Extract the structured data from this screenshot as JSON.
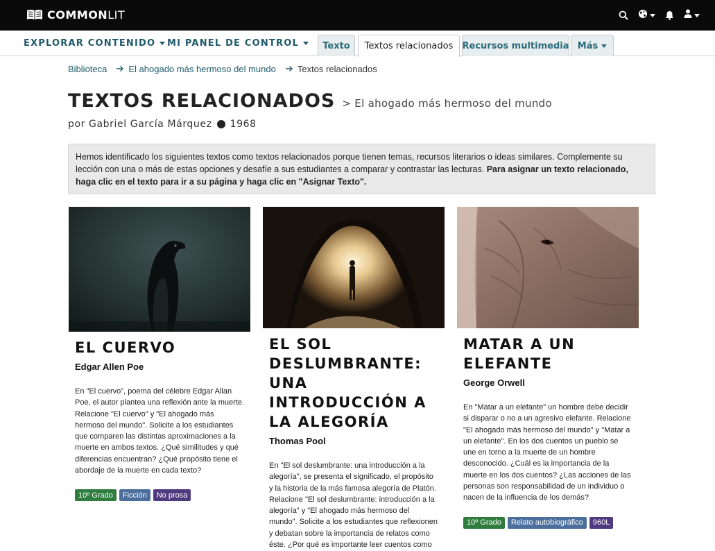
{
  "header": {
    "logo_bold": "COMMON",
    "logo_light": "LIT",
    "icons": [
      "search-icon",
      "globe-icon",
      "bell-icon",
      "user-icon"
    ]
  },
  "subnav": {
    "explore_label": "EXPLORAR CONTENIDO",
    "dashboard_label": "MI PANEL DE CONTROL",
    "tabs": [
      {
        "label": "Texto",
        "active": false
      },
      {
        "label": "Textos relacionados",
        "active": true
      },
      {
        "label": "Recursos multimedia",
        "active": false
      },
      {
        "label": "Más",
        "active": false
      }
    ]
  },
  "breadcrumb": {
    "items": [
      "Biblioteca",
      "El ahogado más hermoso del mundo"
    ],
    "current": "Textos relacionados"
  },
  "page": {
    "title": "TEXTOS RELACIONADOS",
    "subtitle": "> El ahogado más hermoso del mundo",
    "byline_author": "por Gabriel García Márquez",
    "byline_year": "1968"
  },
  "info": {
    "text": "Hemos identificado los siguientes textos como textos relacionados porque tienen temas, recursos literarios o ideas similares. Complemente su lección con una o más de estas opciones y desafíe a sus estudiantes a comparar y contrastar las lecturas.",
    "bold": "Para asignar un texto relacionado, haga clic en el texto para ir a su página y haga clic en \"Asignar Texto\"."
  },
  "cards": [
    {
      "title": "EL CUERVO",
      "author": "Edgar Allen Poe",
      "image": "raven-photo",
      "description": "En \"El cuervo\", poema del célebre Edgar Allan Poe, el autor plantea una reflexión ante la muerte. Relacione \"El cuervo\" y \"El ahogado más hermoso del mundo\". Solicite a los estudiantes que comparen las distintas aproximaciones a la muerte en ambos textos. ¿Qué similitudes y qué diferencias encuentran? ¿Qué propósito tiene el abordaje de la muerte en cada texto?",
      "tags": [
        {
          "label": "10º Grado",
          "color": "#2e7d3e"
        },
        {
          "label": "Ficción",
          "color": "#4b6e9c"
        },
        {
          "label": "No prosa",
          "color": "#4f3a80"
        }
      ]
    },
    {
      "title": "EL SOL DESLUMBRANTE: UNA INTRODUCCIÓN A LA ALEGORÍA",
      "author": "Thomas Pool",
      "image": "cave-photo",
      "description": "En \"El sol deslumbrante: una introducción a la alegoría\", se presenta el significado, el propósito y la historia de la más famosa alegoría de Platón. Relacione \"El sol deslumbrante: introducción a la alegoría\" y \"El ahogado más hermoso del mundo\". Solicite a los estudiantes que reflexionen y debatan sobre la importancia de relatos como éste. ¿Por qué es importante leer cuentos como este?",
      "tags": []
    },
    {
      "title": "MATAR A UN ELEFANTE",
      "author": "George Orwell",
      "image": "elephant-photo",
      "description": "En \"Matar a un elefante\" un hombre debe decidir si disparar o no a un agresivo elefante. Relacione \"El ahogado más hermoso del mundo\" y \"Matar a un elefante\". En los dos cuentos un pueblo se une en torno a la muerte de un hombre desconocido. ¿Cuál es la importancia de la muerte en los dos cuentos? ¿Las acciones de las personas son responsabilidad de un individuo o nacen de la influencia de los demás?",
      "tags": [
        {
          "label": "10º Grado",
          "color": "#2e7d3e"
        },
        {
          "label": "Relato autobiográfico",
          "color": "#4b6e9c"
        },
        {
          "label": "960L",
          "color": "#4f3a80"
        }
      ]
    }
  ]
}
